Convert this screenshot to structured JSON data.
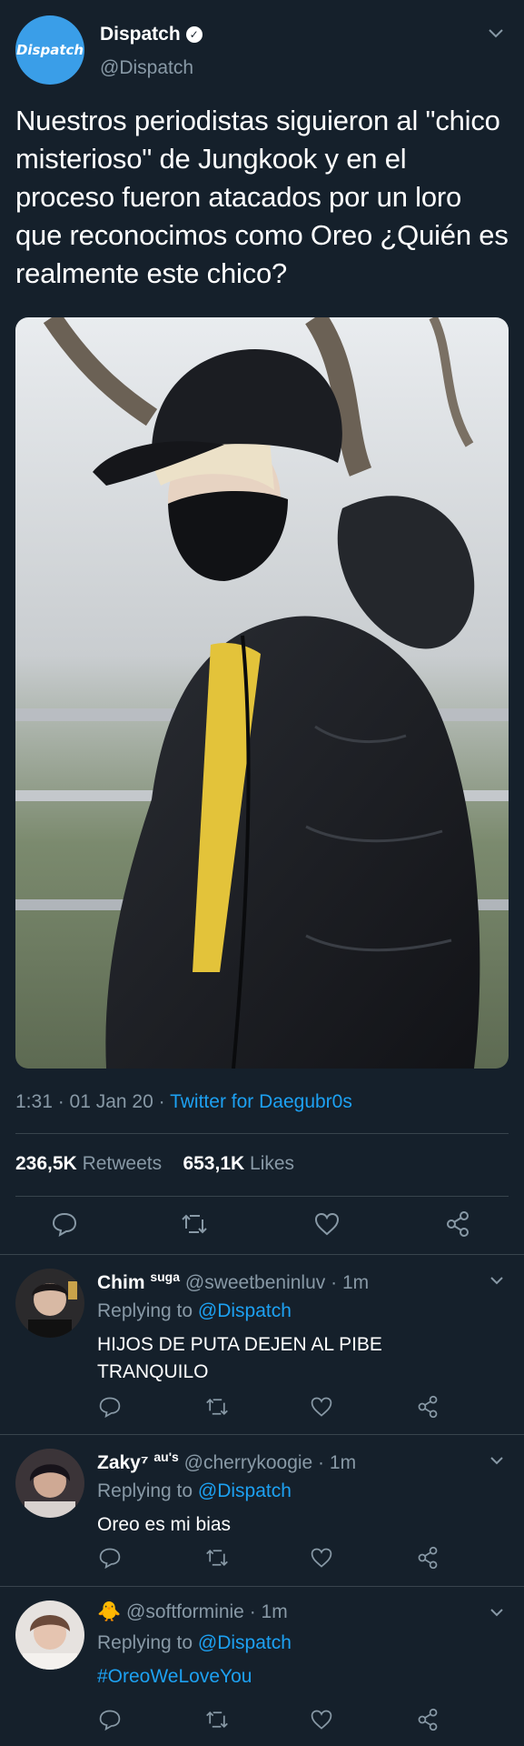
{
  "tweet": {
    "avatar_text": "Dispatch",
    "author_name": "Dispatch",
    "author_handle": "@Dispatch",
    "text": "Nuestros periodistas siguieron al \"chico misterioso\" de Jungkook y en el proceso fueron atacados por un loro que reconocimos como Oreo ¿Quién es realmente este chico?",
    "time": "1:31",
    "date": "01 Jan 20",
    "source": "Twitter for Daegubr0s",
    "retweets_count": "236,5K",
    "retweets_label": "Retweets",
    "likes_count": "653,1K",
    "likes_label": "Likes"
  },
  "replies": [
    {
      "name": "Chim",
      "name_suffix": "suga",
      "handle": "@sweetbeninluv",
      "time": "1m",
      "replying_label": "Replying to",
      "replying_to": "@Dispatch",
      "text": "HIJOS DE PUTA DEJEN AL PIBE TRANQUILO"
    },
    {
      "name": "Zaky⁷",
      "name_suffix": "au's",
      "handle": "@cherrykoogie",
      "time": "1m",
      "replying_label": "Replying to",
      "replying_to": "@Dispatch",
      "text": "Oreo es mi bias"
    },
    {
      "name": "🐥",
      "name_suffix": "",
      "handle": "@softforminie",
      "time": "1m",
      "replying_label": "Replying to",
      "replying_to": "@Dispatch",
      "text": "#OreoWeLoveYou"
    }
  ],
  "icons": {
    "action_row": [
      "reply-icon",
      "retweet-icon",
      "like-icon",
      "share-icon"
    ],
    "verified": "verified-badge-icon",
    "menu": "chevron-down-icon"
  },
  "colors": {
    "background": "#15202b",
    "text": "#ffffff",
    "muted": "#8899a6",
    "link": "#1da1f2",
    "divider": "#38444d"
  }
}
